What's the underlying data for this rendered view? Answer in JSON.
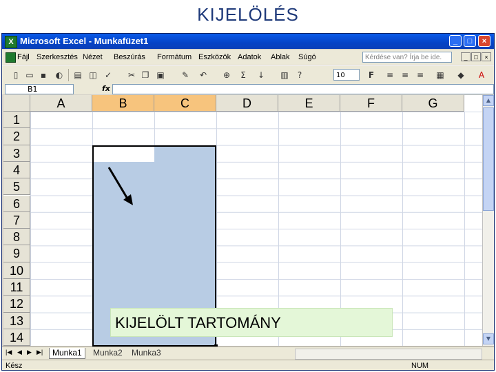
{
  "slide_title": "KIJELÖLÉS",
  "window": {
    "title": "Microsoft Excel - Munkafüzet1"
  },
  "menu": [
    "Fájl",
    "Szerkesztés",
    "Nézet",
    "Beszúrás",
    "Formátum",
    "Eszközök",
    "Adatok",
    "Ablak",
    "Súgó"
  ],
  "help_box": {
    "placeholder": "Kérdése van? Írja be ide."
  },
  "toolbar": {
    "font_size": "10"
  },
  "formula_bar": {
    "name_box": "B1",
    "fx": "fx",
    "content": ""
  },
  "columns": [
    "A",
    "B",
    "C",
    "D",
    "E",
    "F",
    "G"
  ],
  "selected_columns": [
    "B",
    "C"
  ],
  "rows": [
    "1",
    "2",
    "3",
    "4",
    "5",
    "6",
    "7",
    "8",
    "9",
    "10",
    "11",
    "12",
    "13",
    "14"
  ],
  "selection": {
    "range": "B1:C12",
    "active_cell": "B1"
  },
  "callout": {
    "text": "KIJELÖLT TARTOMÁNY"
  },
  "sheet_tabs": [
    "Munka1",
    "Munka2",
    "Munka3"
  ],
  "active_sheet": "Munka1",
  "status": {
    "left": "Kész",
    "num": "NUM"
  },
  "colors": {
    "selection_fill": "#b8cce4",
    "selected_header": "#f7c47d",
    "callout_fill": "#e4f7d8",
    "title_color": "#1f3a7a"
  }
}
